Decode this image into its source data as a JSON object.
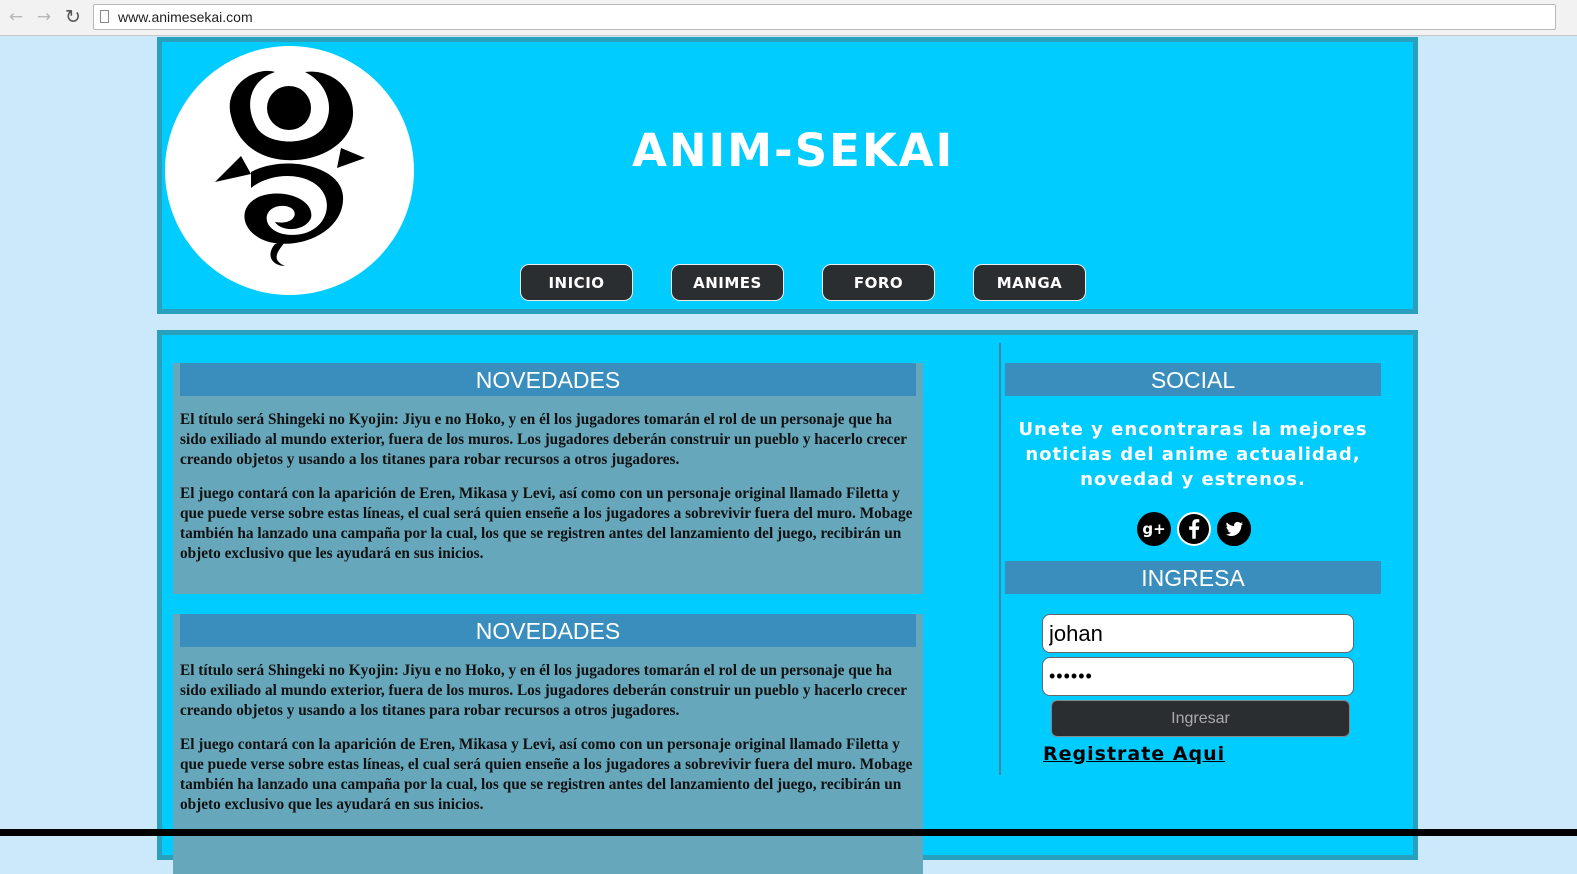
{
  "browser": {
    "url": "www.animesekai.com",
    "back_icon": "←",
    "forward_icon": "→",
    "reload_icon": "↻"
  },
  "header": {
    "title": "ANIM-SEKAI",
    "nav": [
      "INICIO",
      "ANIMES",
      "FORO",
      "MANGA"
    ]
  },
  "articles": [
    {
      "heading": "NOVEDADES",
      "paragraphs": [
        "El título será Shingeki no Kyojin: Jiyu e no Hoko, y en él los jugadores tomarán el rol de un personaje que ha sido exiliado al mundo exterior, fuera de los muros. Los jugadores deberán construir un pueblo y hacerlo crecer creando objetos y usando a los titanes para robar recursos a otros jugadores.",
        "El juego contará con la aparición de Eren, Mikasa y Levi, así como con un personaje original llamado Filetta y que puede verse sobre estas líneas, el cual será quien enseñe a los jugadores a sobrevivir fuera del muro. Mobage también ha lanzado una campaña por la cual, los que se registren antes del lanzamiento del juego, recibirán un objeto exclusivo que les ayudará en sus inicios."
      ]
    },
    {
      "heading": "NOVEDADES",
      "paragraphs": [
        "El título será Shingeki no Kyojin: Jiyu e no Hoko, y en él los jugadores tomarán el rol de un personaje que ha sido exiliado al mundo exterior, fuera de los muros. Los jugadores deberán construir un pueblo y hacerlo crecer creando objetos y usando a los titanes para robar recursos a otros jugadores.",
        "El juego contará con la aparición de Eren, Mikasa y Levi, así como con un personaje original llamado Filetta y que puede verse sobre estas líneas, el cual será quien enseñe a los jugadores a sobrevivir fuera del muro. Mobage también ha lanzado una campaña por la cual, los que se registren antes del lanzamiento del juego, recibirán un objeto exclusivo que les ayudará en sus inicios."
      ]
    }
  ],
  "sidebar": {
    "social_heading": "SOCIAL",
    "social_text": "Unete y encontraras la mejores noticias del anime actualidad, novedad y estrenos.",
    "social_icons": [
      {
        "name": "google-plus-icon",
        "glyph": "g+"
      },
      {
        "name": "facebook-icon",
        "glyph": "f"
      },
      {
        "name": "twitter-icon",
        "glyph": "🐦"
      }
    ],
    "login_heading": "INGRESA",
    "username_value": "johan",
    "password_value": "••••••",
    "login_button": "Ingresar",
    "register_link": "Registrate Aqui"
  },
  "colors": {
    "page_bg": "#cce8fb",
    "panel_bg": "#00ccff",
    "panel_border": "#2aa0bf",
    "heading_bar": "#3a8ebe",
    "article_bg": "#66a7bb",
    "dark_button": "#2b2e31"
  }
}
